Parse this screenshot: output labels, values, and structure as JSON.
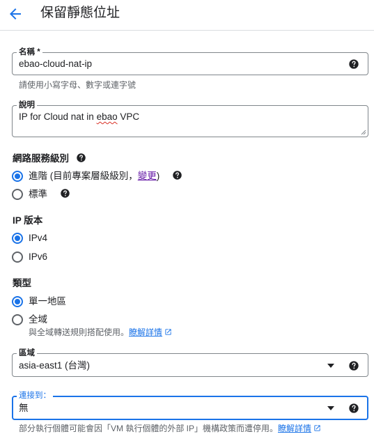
{
  "header": {
    "title": "保留靜態位址"
  },
  "name_field": {
    "label": "名稱 *",
    "value": "ebao-cloud-nat-ip",
    "hint": "請使用小寫字母、數字或連字號"
  },
  "description_field": {
    "label": "說明",
    "value_before": "IP for Cloud nat in ",
    "value_misspelled": "ebao",
    "value_after": " VPC"
  },
  "network_tier": {
    "title": "網路服務級別",
    "options": [
      {
        "label_before": "進階 (目前專案層級級別，",
        "link": "變更",
        "label_after": ")",
        "checked": true
      },
      {
        "label": "標準",
        "checked": false
      }
    ]
  },
  "ip_version": {
    "title": "IP 版本",
    "options": [
      {
        "label": "IPv4",
        "checked": true
      },
      {
        "label": "IPv6",
        "checked": false
      }
    ]
  },
  "type": {
    "title": "類型",
    "options": [
      {
        "label": "單一地區",
        "checked": true
      },
      {
        "label": "全域",
        "checked": false
      }
    ],
    "global_hint": "與全域轉送規則搭配使用。",
    "learn_more": "瞭解詳情"
  },
  "region_field": {
    "label": "區域",
    "value": "asia-east1 (台灣)"
  },
  "attach_field": {
    "label": "連接到：",
    "value": "無",
    "hint": "部分執行個體可能會因「VM 執行個體的外部 IP」機構政策而遭停用。",
    "learn_more": "瞭解詳情"
  },
  "colors": {
    "accent": "#1a73e8",
    "border": "#80868b",
    "link_visited": "#681da8"
  },
  "icons": [
    "arrow-back-icon",
    "help-icon",
    "caret-down-icon",
    "open-in-new-icon",
    "resize-handle-icon"
  ]
}
